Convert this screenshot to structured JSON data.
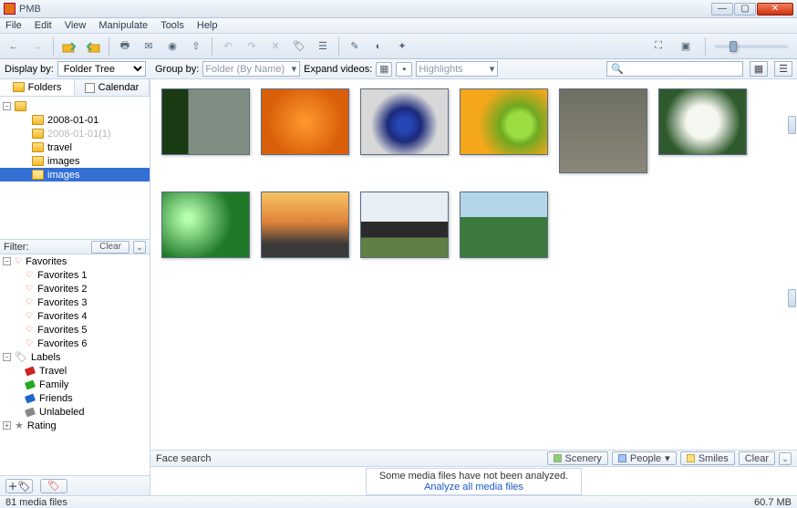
{
  "window": {
    "title": "PMB"
  },
  "menu": [
    "File",
    "Edit",
    "View",
    "Manipulate",
    "Tools",
    "Help"
  ],
  "displayBy": {
    "label": "Display by:",
    "value": "Folder Tree"
  },
  "groupBy": {
    "label": "Group by:",
    "value": "Folder (By Name)"
  },
  "expandVideos": {
    "label": "Expand videos:"
  },
  "highlights": {
    "value": "Highlights"
  },
  "sidebar": {
    "tabs": {
      "folders": "Folders",
      "calendar": "Calendar"
    },
    "tree": [
      {
        "label": "2008-01-01"
      },
      {
        "label": "2008-01-01(1)",
        "dim": true
      },
      {
        "label": "travel"
      },
      {
        "label": "images"
      },
      {
        "label": "images",
        "selected": true
      }
    ]
  },
  "filter": {
    "title": "Filter:",
    "clear": "Clear",
    "favorites": {
      "title": "Favorites",
      "items": [
        "Favorites 1",
        "Favorites 2",
        "Favorites 3",
        "Favorites 4",
        "Favorites 5",
        "Favorites 6"
      ]
    },
    "labels": {
      "title": "Labels",
      "items": [
        {
          "label": "Travel",
          "color": "#c22"
        },
        {
          "label": "Family",
          "color": "#2a2"
        },
        {
          "label": "Friends",
          "color": "#26c"
        },
        {
          "label": "Unlabeled",
          "color": "#888"
        }
      ]
    },
    "rating": {
      "title": "Rating"
    }
  },
  "facesearch": {
    "label": "Face search",
    "scenery": "Scenery",
    "people": "People",
    "smiles": "Smiles",
    "clear": "Clear"
  },
  "analyze": {
    "msg": "Some media files have not been analyzed.",
    "link": "Analyze all media files"
  },
  "status": {
    "left": "81 media files",
    "right": "60.7 MB"
  },
  "thumbs": [
    {
      "bg": "linear-gradient(90deg,#1a3a14 30%,#7f8e82 30%)"
    },
    {
      "bg": "radial-gradient(circle at 50% 50%, #ff9a2e 0%, #d95f0a 70%)"
    },
    {
      "bg": "radial-gradient(circle at 50% 55%, #2646b5 12%, #1b2a7a 30%, #d8d8d8 60%)"
    },
    {
      "bg": "radial-gradient(circle at 68% 55%, #9cdd42 18%, #6ea821 28%, #f5a71b 60%)"
    },
    {
      "bg": "linear-gradient(#6f6f65,#8a8678)",
      "tall": true
    },
    {
      "bg": "radial-gradient(circle at 50% 50%, #f4f7ef 30%, #2f5a2d 70%)"
    },
    {
      "bg": "radial-gradient(circle at 30% 40%, #b7ffb0 5%, #1f7a28 60%)"
    },
    {
      "bg": "linear-gradient(#f6c463 0%,#e0843a 45%,#3a3a3a 80%)"
    },
    {
      "bg": "linear-gradient(#e7eef4 45%,#2a2a2a 45% 70%,#5f7f44 70%)"
    },
    {
      "bg": "linear-gradient(#b3d7e8 38%,#3b7a3c 38%)"
    }
  ]
}
